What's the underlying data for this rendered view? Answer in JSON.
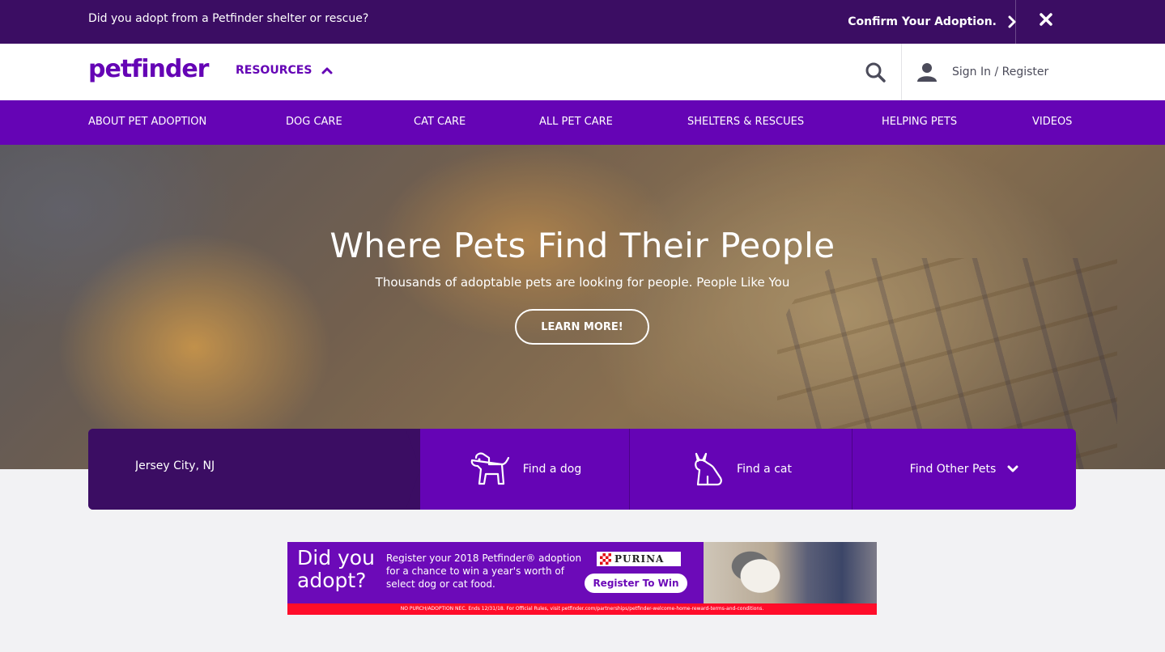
{
  "banner": {
    "question": "Did you adopt from a Petfinder shelter or rescue?",
    "confirm_label": "Confirm Your Adoption."
  },
  "header": {
    "logo_text": "petfinder",
    "resources_label": "RESOURCES",
    "signin_label": "Sign In / Register"
  },
  "nav": {
    "items": [
      {
        "label": "ABOUT PET ADOPTION"
      },
      {
        "label": "DOG CARE"
      },
      {
        "label": "CAT CARE"
      },
      {
        "label": "ALL PET CARE"
      },
      {
        "label": "SHELTERS & RESCUES"
      },
      {
        "label": "HELPING PETS"
      },
      {
        "label": "VIDEOS"
      }
    ]
  },
  "hero": {
    "title": "Where Pets Find Their People",
    "subtitle": "Thousands of adoptable pets are looking for people. People Like You",
    "cta_label": "LEARN MORE!"
  },
  "search": {
    "location_value": "Jersey City, NJ",
    "find_dog_label": "Find a dog",
    "find_cat_label": "Find a cat",
    "find_other_label": "Find Other Pets"
  },
  "ad": {
    "headline_line1": "Did you",
    "headline_line2": "adopt?",
    "body": "Register your 2018 Petfinder® adoption for a chance to win a year's worth of select dog or cat food.",
    "brand": "PURINA",
    "button_label": "Register To Win",
    "disclaimer": "NO PURCH/ADOPTION NEC. Ends 12/31/18. For Official Rules, visit petfinder.com/partnerships/petfinder-welcome-home-reward-terms-and-conditions."
  },
  "colors": {
    "brand_purple": "#6504b5",
    "dark_purple": "#3b0d63",
    "ad_red": "#ff0d2a"
  }
}
